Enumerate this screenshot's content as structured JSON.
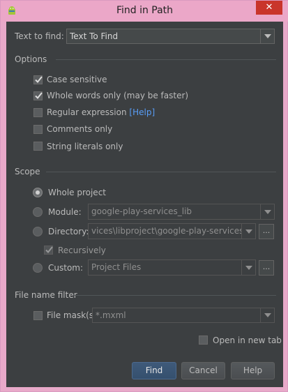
{
  "window": {
    "title": "Find in Path",
    "close_glyph": "✕"
  },
  "text_to_find": {
    "label": "Text to find:",
    "value": "Text To Find"
  },
  "options": {
    "header": "Options",
    "case_sensitive": {
      "label": "Case sensitive",
      "checked": true
    },
    "whole_words": {
      "label": "Whole words only (may be faster)",
      "checked": true
    },
    "regex": {
      "label": "Regular expression",
      "help_link": "[Help]",
      "checked": false
    },
    "comments_only": {
      "label": "Comments only",
      "checked": false
    },
    "string_literals_only": {
      "label": "String literals only",
      "checked": false
    }
  },
  "scope": {
    "header": "Scope",
    "whole_project": {
      "label": "Whole project",
      "selected": true
    },
    "module": {
      "label": "Module:",
      "value": "google-play-services_lib",
      "selected": false
    },
    "directory": {
      "label": "Directory:",
      "value": "vices\\libproject\\google-play-services_lib",
      "selected": false,
      "browse": "..."
    },
    "recursively": {
      "label": "Recursively",
      "checked": true
    },
    "custom": {
      "label": "Custom:",
      "value": "Project Files",
      "selected": false,
      "browse": "..."
    }
  },
  "file_filter": {
    "header": "File name filter",
    "file_mask": {
      "label": "File mask(s)",
      "value": "*.mxml",
      "checked": false
    }
  },
  "open_in_new_tab": {
    "label": "Open in new tab",
    "checked": false
  },
  "buttons": {
    "find": "Find",
    "cancel": "Cancel",
    "help": "Help"
  },
  "colors": {
    "background": "#3c3f41",
    "title_bar": "#eba7c8",
    "link": "#589df6",
    "close": "#c9352b"
  }
}
